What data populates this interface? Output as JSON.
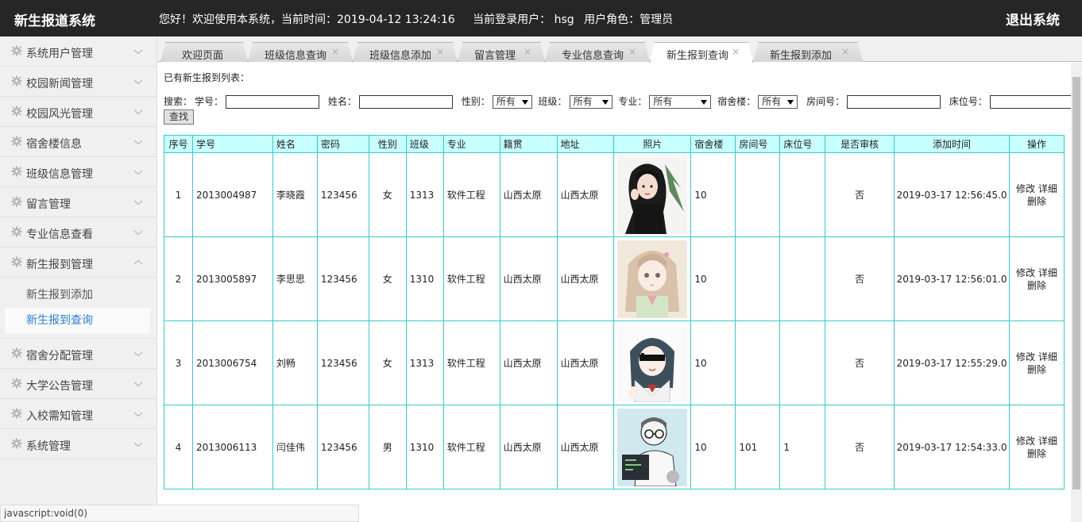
{
  "header": {
    "brand": "新生报道系统",
    "welcome": "您好！欢迎使用本系统，当前时间：2019-04-12 13:24:16",
    "current_user": "当前登录用户： hsg",
    "role": "用户角色：管理员",
    "logout": "退出系统"
  },
  "sidebar": {
    "items": [
      {
        "label": "系统用户管理"
      },
      {
        "label": "校园新闻管理"
      },
      {
        "label": "校园风光管理"
      },
      {
        "label": "宿舍楼信息"
      },
      {
        "label": "班级信息管理"
      },
      {
        "label": "留言管理"
      },
      {
        "label": "专业信息查看"
      },
      {
        "label": "新生报到管理"
      }
    ],
    "subitems": [
      {
        "label": "新生报到添加"
      },
      {
        "label": "新生报到查询"
      }
    ],
    "items_after": [
      {
        "label": "宿舍分配管理"
      },
      {
        "label": "大学公告管理"
      },
      {
        "label": "入校需知管理"
      },
      {
        "label": "系统管理"
      }
    ]
  },
  "tabs": [
    {
      "label": "欢迎页面",
      "close": ""
    },
    {
      "label": "班级信息查询",
      "close": "×"
    },
    {
      "label": "班级信息添加",
      "close": "×"
    },
    {
      "label": "留言管理",
      "close": "×"
    },
    {
      "label": "专业信息查询",
      "close": "×"
    },
    {
      "label": "新生报到查询",
      "close": "×"
    },
    {
      "label": "新生报到添加",
      "close": "×"
    }
  ],
  "content": {
    "title": "已有新生报到列表：",
    "search": {
      "prefix": "搜索：",
      "student_no": "学号：",
      "name": "姓名：",
      "gender": "性别：",
      "gender_value": "所有",
      "class": "班级：",
      "class_value": "所有",
      "major": "专业：",
      "major_value": "所有",
      "dorm": "宿舍楼：",
      "dorm_value": "所有",
      "room": "房间号：",
      "bed": "床位号：",
      "button": "查找"
    },
    "columns": [
      "序号",
      "学号",
      "姓名",
      "密码",
      "性别",
      "班级",
      "专业",
      "籍贯",
      "地址",
      "照片",
      "宿舍楼",
      "房间号",
      "床位号",
      "是否审核",
      "添加时间",
      "操作"
    ],
    "rows": [
      {
        "idx": "1",
        "sno": "2013004987",
        "name": "李晓霞",
        "pwd": "123456",
        "gender": "女",
        "class": "1313",
        "major": "软件工程",
        "origin": "山西太原",
        "addr": "山西太原",
        "dorm": "10",
        "room": "",
        "bed": "",
        "audit": "否",
        "time": "2019-03-17 12:56:45.0"
      },
      {
        "idx": "2",
        "sno": "2013005897",
        "name": "李思思",
        "pwd": "123456",
        "gender": "女",
        "class": "1310",
        "major": "软件工程",
        "origin": "山西太原",
        "addr": "山西太原",
        "dorm": "10",
        "room": "",
        "bed": "",
        "audit": "否",
        "time": "2019-03-17 12:56:01.0"
      },
      {
        "idx": "3",
        "sno": "2013006754",
        "name": "刘畅",
        "pwd": "123456",
        "gender": "女",
        "class": "1313",
        "major": "软件工程",
        "origin": "山西太原",
        "addr": "山西太原",
        "dorm": "10",
        "room": "",
        "bed": "",
        "audit": "否",
        "time": "2019-03-17 12:55:29.0"
      },
      {
        "idx": "4",
        "sno": "2013006113",
        "name": "闫佳伟",
        "pwd": "123456",
        "gender": "男",
        "class": "1310",
        "major": "软件工程",
        "origin": "山西太原",
        "addr": "山西太原",
        "dorm": "10",
        "room": "101",
        "bed": "1",
        "audit": "否",
        "time": "2019-03-17 12:54:33.0"
      }
    ],
    "ops": {
      "edit": "修改",
      "detail": "详细",
      "delete": "删除"
    }
  },
  "status": "javascript:void(0)",
  "colors": {
    "header_bg": "#262626",
    "table_border": "#33cccc",
    "table_header_bg": "#c8ffff",
    "active_sub": "#2a7fd4"
  }
}
